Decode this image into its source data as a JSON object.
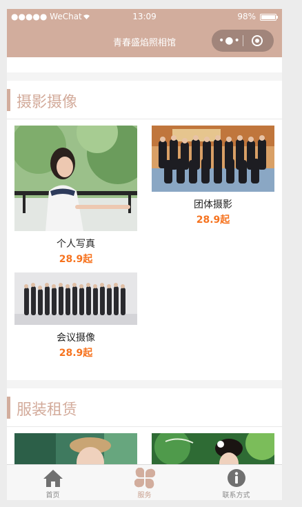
{
  "status_bar": {
    "carrier": "●●●●● WeChat",
    "time": "13:09",
    "battery": "98%",
    "battery_level": 0.98
  },
  "nav": {
    "title": "青春盛焰照相馆"
  },
  "sections": [
    {
      "title": "摄影摄像",
      "items": [
        {
          "name": "个人写真",
          "price": "28.9起"
        },
        {
          "name": "团体摄影",
          "price": "28.9起"
        },
        {
          "name": "会议摄像",
          "price": "28.9起"
        }
      ]
    },
    {
      "title": "服装租赁"
    }
  ],
  "tabbar": {
    "items": [
      {
        "label": "首页",
        "icon": "home-icon"
      },
      {
        "label": "服务",
        "icon": "clover-icon"
      },
      {
        "label": "联系方式",
        "icon": "info-icon"
      }
    ],
    "active_color": "#d2ad9d",
    "inactive_color": "#707070"
  },
  "colors": {
    "accent": "#d2ad9d",
    "price": "#f6731f"
  }
}
